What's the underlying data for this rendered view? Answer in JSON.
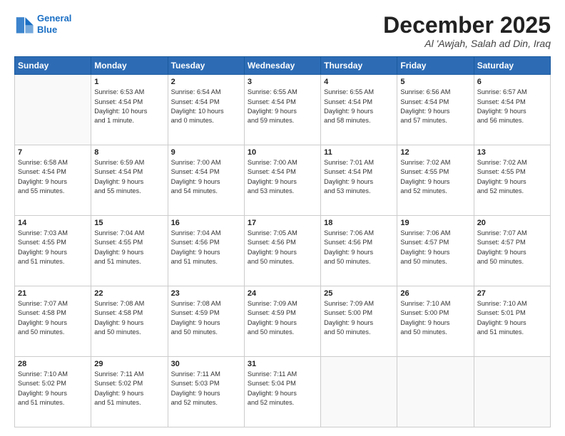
{
  "header": {
    "logo_line1": "General",
    "logo_line2": "Blue",
    "month": "December 2025",
    "location": "Al 'Awjah, Salah ad Din, Iraq"
  },
  "days_of_week": [
    "Sunday",
    "Monday",
    "Tuesday",
    "Wednesday",
    "Thursday",
    "Friday",
    "Saturday"
  ],
  "weeks": [
    [
      {
        "day": "",
        "info": ""
      },
      {
        "day": "1",
        "info": "Sunrise: 6:53 AM\nSunset: 4:54 PM\nDaylight: 10 hours\nand 1 minute."
      },
      {
        "day": "2",
        "info": "Sunrise: 6:54 AM\nSunset: 4:54 PM\nDaylight: 10 hours\nand 0 minutes."
      },
      {
        "day": "3",
        "info": "Sunrise: 6:55 AM\nSunset: 4:54 PM\nDaylight: 9 hours\nand 59 minutes."
      },
      {
        "day": "4",
        "info": "Sunrise: 6:55 AM\nSunset: 4:54 PM\nDaylight: 9 hours\nand 58 minutes."
      },
      {
        "day": "5",
        "info": "Sunrise: 6:56 AM\nSunset: 4:54 PM\nDaylight: 9 hours\nand 57 minutes."
      },
      {
        "day": "6",
        "info": "Sunrise: 6:57 AM\nSunset: 4:54 PM\nDaylight: 9 hours\nand 56 minutes."
      }
    ],
    [
      {
        "day": "7",
        "info": "Sunrise: 6:58 AM\nSunset: 4:54 PM\nDaylight: 9 hours\nand 55 minutes."
      },
      {
        "day": "8",
        "info": "Sunrise: 6:59 AM\nSunset: 4:54 PM\nDaylight: 9 hours\nand 55 minutes."
      },
      {
        "day": "9",
        "info": "Sunrise: 7:00 AM\nSunset: 4:54 PM\nDaylight: 9 hours\nand 54 minutes."
      },
      {
        "day": "10",
        "info": "Sunrise: 7:00 AM\nSunset: 4:54 PM\nDaylight: 9 hours\nand 53 minutes."
      },
      {
        "day": "11",
        "info": "Sunrise: 7:01 AM\nSunset: 4:54 PM\nDaylight: 9 hours\nand 53 minutes."
      },
      {
        "day": "12",
        "info": "Sunrise: 7:02 AM\nSunset: 4:55 PM\nDaylight: 9 hours\nand 52 minutes."
      },
      {
        "day": "13",
        "info": "Sunrise: 7:02 AM\nSunset: 4:55 PM\nDaylight: 9 hours\nand 52 minutes."
      }
    ],
    [
      {
        "day": "14",
        "info": "Sunrise: 7:03 AM\nSunset: 4:55 PM\nDaylight: 9 hours\nand 51 minutes."
      },
      {
        "day": "15",
        "info": "Sunrise: 7:04 AM\nSunset: 4:55 PM\nDaylight: 9 hours\nand 51 minutes."
      },
      {
        "day": "16",
        "info": "Sunrise: 7:04 AM\nSunset: 4:56 PM\nDaylight: 9 hours\nand 51 minutes."
      },
      {
        "day": "17",
        "info": "Sunrise: 7:05 AM\nSunset: 4:56 PM\nDaylight: 9 hours\nand 50 minutes."
      },
      {
        "day": "18",
        "info": "Sunrise: 7:06 AM\nSunset: 4:56 PM\nDaylight: 9 hours\nand 50 minutes."
      },
      {
        "day": "19",
        "info": "Sunrise: 7:06 AM\nSunset: 4:57 PM\nDaylight: 9 hours\nand 50 minutes."
      },
      {
        "day": "20",
        "info": "Sunrise: 7:07 AM\nSunset: 4:57 PM\nDaylight: 9 hours\nand 50 minutes."
      }
    ],
    [
      {
        "day": "21",
        "info": "Sunrise: 7:07 AM\nSunset: 4:58 PM\nDaylight: 9 hours\nand 50 minutes."
      },
      {
        "day": "22",
        "info": "Sunrise: 7:08 AM\nSunset: 4:58 PM\nDaylight: 9 hours\nand 50 minutes."
      },
      {
        "day": "23",
        "info": "Sunrise: 7:08 AM\nSunset: 4:59 PM\nDaylight: 9 hours\nand 50 minutes."
      },
      {
        "day": "24",
        "info": "Sunrise: 7:09 AM\nSunset: 4:59 PM\nDaylight: 9 hours\nand 50 minutes."
      },
      {
        "day": "25",
        "info": "Sunrise: 7:09 AM\nSunset: 5:00 PM\nDaylight: 9 hours\nand 50 minutes."
      },
      {
        "day": "26",
        "info": "Sunrise: 7:10 AM\nSunset: 5:00 PM\nDaylight: 9 hours\nand 50 minutes."
      },
      {
        "day": "27",
        "info": "Sunrise: 7:10 AM\nSunset: 5:01 PM\nDaylight: 9 hours\nand 51 minutes."
      }
    ],
    [
      {
        "day": "28",
        "info": "Sunrise: 7:10 AM\nSunset: 5:02 PM\nDaylight: 9 hours\nand 51 minutes."
      },
      {
        "day": "29",
        "info": "Sunrise: 7:11 AM\nSunset: 5:02 PM\nDaylight: 9 hours\nand 51 minutes."
      },
      {
        "day": "30",
        "info": "Sunrise: 7:11 AM\nSunset: 5:03 PM\nDaylight: 9 hours\nand 52 minutes."
      },
      {
        "day": "31",
        "info": "Sunrise: 7:11 AM\nSunset: 5:04 PM\nDaylight: 9 hours\nand 52 minutes."
      },
      {
        "day": "",
        "info": ""
      },
      {
        "day": "",
        "info": ""
      },
      {
        "day": "",
        "info": ""
      }
    ]
  ]
}
